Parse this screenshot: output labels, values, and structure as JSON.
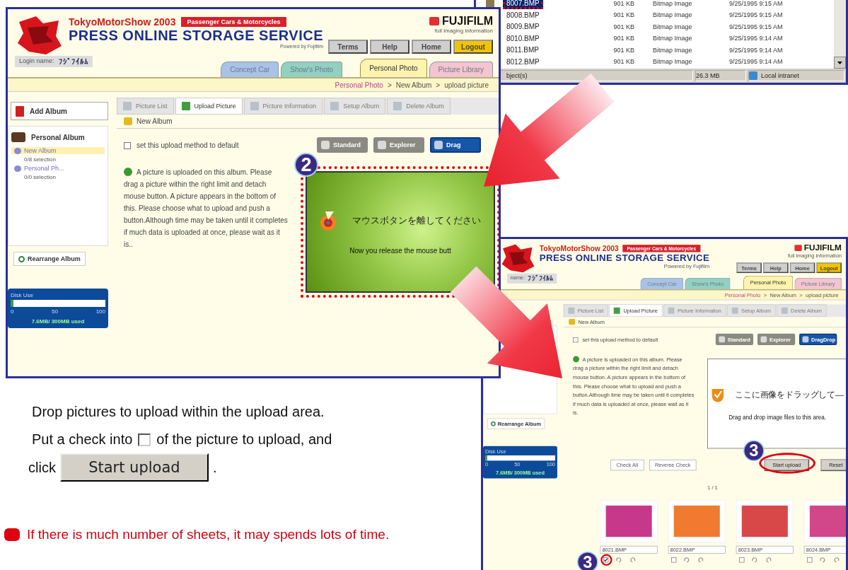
{
  "upload_shot": {
    "brand": {
      "show_title": "TokyoMotorShow 2003",
      "category": "Passenger Cars & Motorcycles",
      "service": "PRESS ONLINE STORAGE SERVICE",
      "powered": "Powered by Fujifilm",
      "maker": "FUJIFILM",
      "maker_sub": "full imaging information"
    },
    "nav_buttons": [
      {
        "label": "Terms",
        "kind": "plain"
      },
      {
        "label": "Help",
        "kind": "plain"
      },
      {
        "label": "Home",
        "kind": "plain"
      },
      {
        "label": "Logout",
        "kind": "accent"
      }
    ],
    "login": {
      "label": "Login name:",
      "value": "ﾌｼﾞﾌｲﾙﾑ"
    },
    "tabs": [
      {
        "label": "Concept Car",
        "color": "#a9c3e6",
        "selected": false
      },
      {
        "label": "Show's Photo",
        "color": "#92d0c2",
        "selected": false
      },
      {
        "label": "Personal Photo",
        "color": "#fff3b0",
        "selected": true
      },
      {
        "label": "Picture Library",
        "color": "#f4c4d0",
        "selected": false
      }
    ],
    "breadcrumb": [
      {
        "label": "Personal Photo",
        "kind": "link"
      },
      {
        "label": ">",
        "kind": "separator"
      },
      {
        "label": "New Album",
        "kind": "text"
      },
      {
        "label": ">",
        "kind": "separator"
      },
      {
        "label": "upload picture",
        "kind": "text"
      }
    ],
    "sidebar": {
      "add_album": "Add Album",
      "album_group": "Personal Album",
      "albums": [
        {
          "name": "New Album",
          "count": "0/8 selection",
          "selected": true
        },
        {
          "name": "Personal Ph...",
          "count": "0/0 selection",
          "selected": false
        }
      ],
      "rearrange": "Rearrange Album",
      "disk": {
        "label": "Disk Use",
        "level": 0.03,
        "ticks": [
          "0",
          "50",
          "100"
        ],
        "reading": "7.6MB/ 300MB used"
      }
    },
    "toolbar": [
      {
        "label": "Picture List",
        "selected": false
      },
      {
        "label": "Upload Picture",
        "selected": true
      },
      {
        "label": "Picture Information",
        "selected": false
      },
      {
        "label": "Setup Album",
        "selected": false
      },
      {
        "label": "Delete Album",
        "selected": false
      }
    ],
    "album_title": "New Album",
    "default_option": {
      "label": "set this upload method to default",
      "checked": false
    },
    "methods": [
      {
        "label": "Standard",
        "selected": false
      },
      {
        "label": "Explorer",
        "selected": false
      },
      {
        "label": "Drag",
        "selected": true
      }
    ],
    "help_text": "A picture is uploaded on this album. Please drag a picture within the right limit and detach mouse button. A picture appears in the bottom of this. Please choose what to upload and push a button.Although time may be taken until it completes if much data is uploaded at once, please wait as it is..",
    "drop_area": {
      "kind": "release",
      "highlighted": true,
      "badge": "2",
      "title": "マウスボタンを離してください",
      "caption": "Now you release the mouse butt"
    }
  },
  "explorer": {
    "rows": [
      {
        "name": "8007.BMP",
        "size": "901 KB",
        "type": "Bitmap Image",
        "modified": "9/25/1995 9:15 AM",
        "selected": true,
        "highlighted": true
      },
      {
        "name": "8008.BMP",
        "size": "901 KB",
        "type": "Bitmap Image",
        "modified": "9/25/1995 9:15 AM",
        "selected": false,
        "highlighted": false
      },
      {
        "name": "8009.BMP",
        "size": "901 KB",
        "type": "Bitmap Image",
        "modified": "9/25/1995 9:15 AM",
        "selected": false,
        "highlighted": false
      },
      {
        "name": "8010.BMP",
        "size": "901 KB",
        "type": "Bitmap Image",
        "modified": "9/25/1995 9:14 AM",
        "selected": false,
        "highlighted": false
      },
      {
        "name": "8011.BMP",
        "size": "901 KB",
        "type": "Bitmap Image",
        "modified": "9/25/1995 9:14 AM",
        "selected": false,
        "highlighted": false
      },
      {
        "name": "8012.BMP",
        "size": "901 KB",
        "type": "Bitmap Image",
        "modified": "9/25/1995 9:14 AM",
        "selected": false,
        "highlighted": false
      }
    ],
    "status": [
      "bject(s)",
      "26.3 MB",
      "Local intranet"
    ]
  },
  "result_shot": {
    "brand": {
      "show_title": "TokyoMotorShow 2003",
      "category": "Passenger Cars & Motorcycles",
      "service": "PRESS ONLINE STORAGE SERVICE",
      "powered": "Powered by Fujifilm",
      "maker": "FUJIFILM",
      "maker_sub": "full imaging information"
    },
    "nav_buttons": [
      {
        "label": "Terms",
        "kind": "plain"
      },
      {
        "label": "Help",
        "kind": "plain"
      },
      {
        "label": "Home",
        "kind": "plain"
      },
      {
        "label": "Logout",
        "kind": "accent"
      }
    ],
    "login": {
      "label": "name:",
      "value": "ﾌｼﾞﾌｲﾙﾑ"
    },
    "tabs": [
      {
        "label": "Concept Car",
        "color": "#a9c3e6",
        "selected": false
      },
      {
        "label": "Show's Photo",
        "color": "#92d0c2",
        "selected": false
      },
      {
        "label": "Personal Photo",
        "color": "#fff3b0",
        "selected": true
      },
      {
        "label": "Picture Library",
        "color": "#f4c4d0",
        "selected": false
      }
    ],
    "breadcrumb": [
      {
        "label": "Personal Photo",
        "kind": "link"
      },
      {
        "label": ">",
        "kind": "separator"
      },
      {
        "label": "New Album",
        "kind": "text"
      },
      {
        "label": ">",
        "kind": "separator"
      },
      {
        "label": "upload picture",
        "kind": "text"
      }
    ],
    "sidebar": {
      "rearrange": "Rearrange Album",
      "disk": {
        "label": "Disk Use",
        "level": 0.03,
        "ticks": [
          "0",
          "50",
          "100"
        ],
        "reading": "7.6MB/ 300MB used"
      }
    },
    "toolbar": [
      {
        "label": "Picture List",
        "selected": false
      },
      {
        "label": "Upload Picture",
        "selected": true
      },
      {
        "label": "Picture Information",
        "selected": false
      },
      {
        "label": "Setup Album",
        "selected": false
      },
      {
        "label": "Delete Album",
        "selected": false
      }
    ],
    "album_title": "New Album",
    "default_option": {
      "label": "set this upload method to default",
      "checked": false
    },
    "methods": [
      {
        "label": "Standard",
        "selected": false
      },
      {
        "label": "Explorer",
        "selected": false
      },
      {
        "label": "DragDrop",
        "selected": true
      }
    ],
    "help_text": "A picture is uploaded on this album. Please drag a picture within the right limit and detach mouse button. A picture appears in the bottom of this. Please choose what to upload and push a button.Although time may be taken until it completes if much data is uploaded at once, please wait as it is.",
    "drop_area": {
      "kind": "drop",
      "title": "ここに画像をドラッグして—",
      "caption": "Drag and drop image files to this area."
    },
    "selection_buttons": [
      "Check All",
      "Reverse Check"
    ],
    "action_buttons": [
      {
        "label": "Start upload",
        "badge": "3"
      },
      {
        "label": "Reset"
      }
    ],
    "pager": "1 / 1",
    "photos": [
      {
        "filename": "8021.BMP",
        "checked": true,
        "badge": "3",
        "color": "#c8388a"
      },
      {
        "filename": "8022.BMP",
        "checked": false,
        "color": "#f07a30"
      },
      {
        "filename": "8023.BMP",
        "checked": false,
        "color": "#d84848"
      },
      {
        "filename": "8024.BMP",
        "checked": false,
        "color": "#d2468a"
      }
    ]
  },
  "instructions": {
    "drop_step": "Drop pictures to upload within the upload area.",
    "check_step": {
      "before": "Put a check into",
      "after": "of the picture to upload, and",
      "click": "click",
      "button": "Start upload",
      "end": "."
    },
    "warning": "If there is much number of sheets, it may spends lots of time."
  }
}
